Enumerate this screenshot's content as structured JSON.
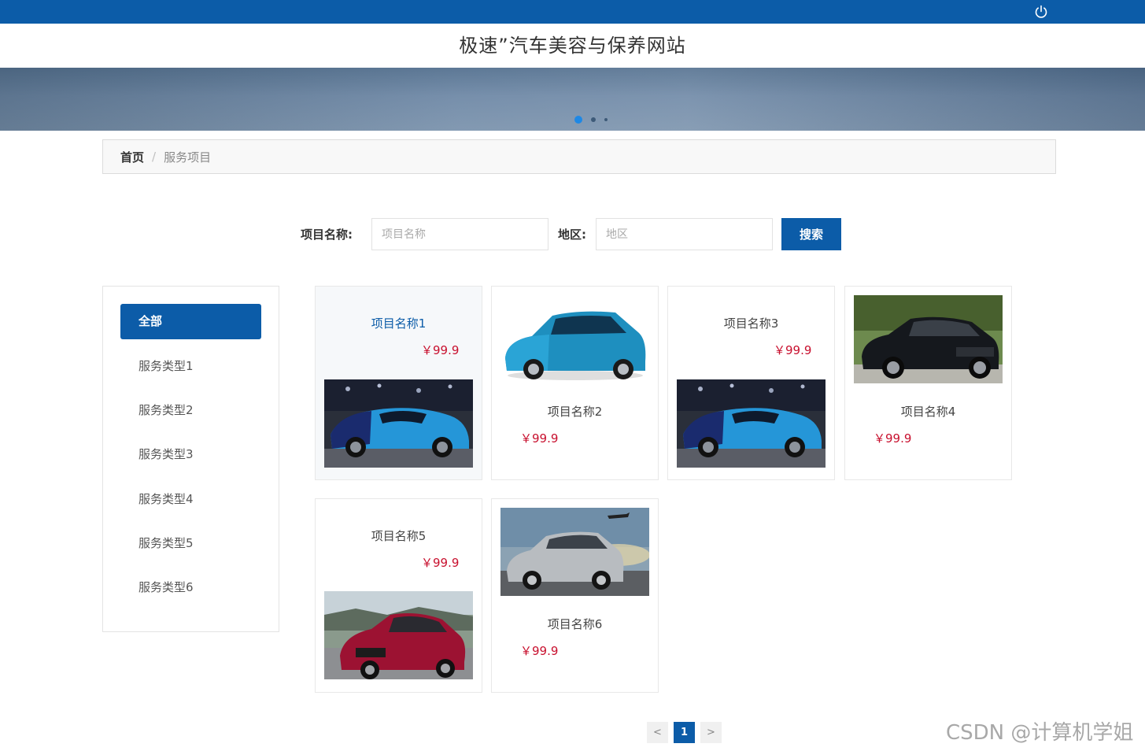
{
  "header": {
    "site_title": "极速”汽车美容与保养网站",
    "power_icon": "power-icon",
    "colors": {
      "topbar": "#0c5ca8",
      "accent": "#0c5ca8",
      "price": "#c8102e"
    }
  },
  "banner": {
    "slides": 3,
    "active_slide": 1
  },
  "breadcrumb": {
    "home": "首页",
    "separator": "/",
    "current": "服务项目"
  },
  "search": {
    "name_label": "项目名称:",
    "name_placeholder": "项目名称",
    "area_label": "地区:",
    "area_placeholder": "地区",
    "button": "搜索"
  },
  "sidebar": {
    "items": [
      {
        "label": "全部",
        "active": true
      },
      {
        "label": "服务类型1"
      },
      {
        "label": "服务类型2"
      },
      {
        "label": "服务类型3"
      },
      {
        "label": "服务类型4"
      },
      {
        "label": "服务类型5"
      },
      {
        "label": "服务类型6"
      }
    ]
  },
  "products": [
    {
      "name": "项目名称1",
      "price": "￥99.9",
      "image": "blue-hypercar-photo",
      "hovered": true
    },
    {
      "name": "项目名称2",
      "price": "￥99.9",
      "image": "blue-hatchback-photo"
    },
    {
      "name": "项目名称3",
      "price": "￥99.9",
      "image": "blue-hypercar-photo"
    },
    {
      "name": "项目名称4",
      "price": "￥99.9",
      "image": "black-sedan-photo"
    },
    {
      "name": "项目名称5",
      "price": "￥99.9",
      "image": "red-coupe-photo"
    },
    {
      "name": "项目名称6",
      "price": "￥99.9",
      "image": "silver-hatchback-photo"
    }
  ],
  "pagination": {
    "prev": "<",
    "current": "1",
    "next": ">"
  },
  "watermark": "CSDN @计算机学姐"
}
